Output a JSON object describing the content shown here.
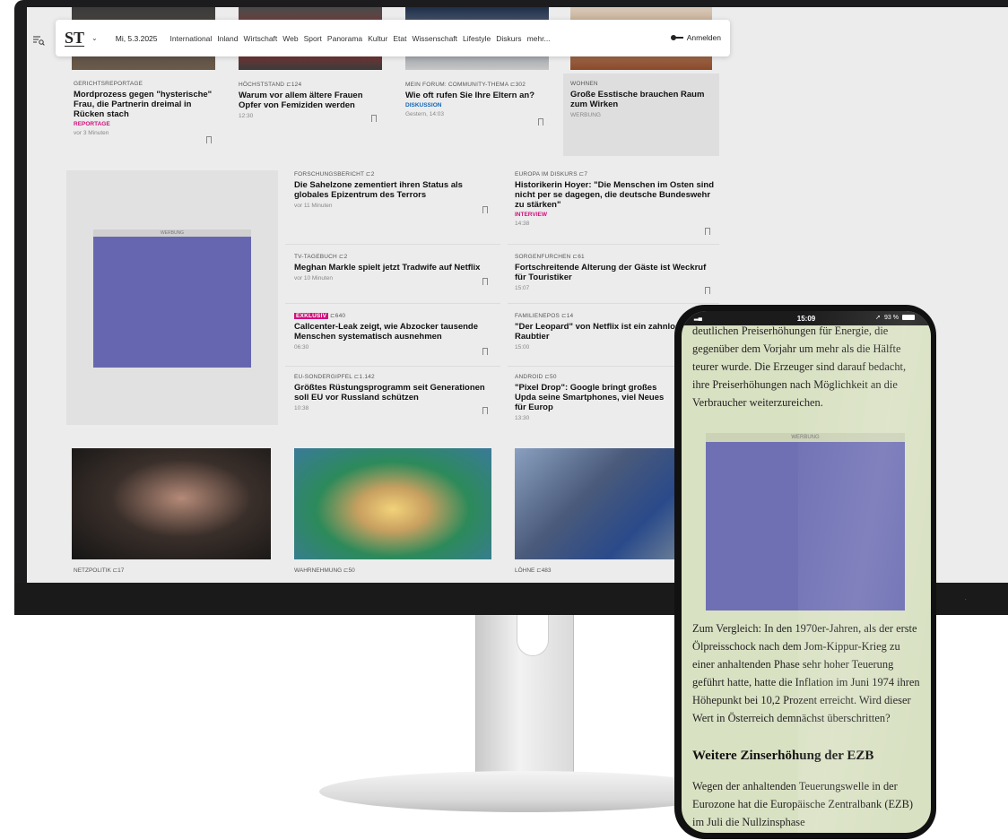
{
  "nav": {
    "logo": "ST",
    "date": "Mi, 5.3.2025",
    "items": [
      "International",
      "Inland",
      "Wirtschaft",
      "Web",
      "Sport",
      "Panorama",
      "Kultur",
      "Etat",
      "Wissenschaft",
      "Lifestyle",
      "Diskurs",
      "mehr..."
    ],
    "login": "Anmelden"
  },
  "top_cards": [
    {
      "kicker": "GERICHTSREPORTAGE",
      "headline": "Mordprozess gegen \"hysterische\" Frau, die Partnerin dreimal in Rücken stach",
      "tag": "REPORTAGE",
      "meta": "vor 3 Minuten"
    },
    {
      "kicker": "HÖCHSTSTAND  ⊏124",
      "headline": "Warum vor allem ältere Frauen Opfer von Femiziden werden",
      "tag": "",
      "meta": "12:30"
    },
    {
      "kicker": "MEIN FORUM: COMMUNITY-THEMA  ⊏302",
      "headline": "Wie oft rufen Sie Ihre Eltern an?",
      "tag": "DISKUSSION",
      "meta": "Gestern, 14:03"
    },
    {
      "kicker": "WOHNEN",
      "headline": "Große Esstische brauchen Raum zum Wirken",
      "tag": "",
      "meta": "WERBUNG"
    }
  ],
  "ad_label": "WERBUNG",
  "mid_left": [
    {
      "kicker": "FORSCHUNGSBERICHT  ⊏2",
      "headline": "Die Sahelzone zementiert ihren Status als globales Epizentrum des Terrors",
      "meta": "vor 11 Minuten"
    },
    {
      "kicker": "TV-TAGEBUCH  ⊏2",
      "headline": "Meghan Markle spielt jetzt Tradwife auf Netflix",
      "meta": "vor 10 Minuten"
    },
    {
      "badge": "EXKLUSIV",
      "kicker": "⊏640",
      "headline": "Callcenter-Leak zeigt, wie Abzocker tausende Menschen systematisch ausnehmen",
      "meta": "06:30"
    },
    {
      "kicker": "EU-SONDERGIPFEL  ⊏1.142",
      "headline": "Größtes Rüstungsprogramm seit Generationen soll EU vor Russland schützen",
      "meta": "10:38"
    }
  ],
  "mid_right": [
    {
      "kicker": "EUROPA IM DISKURS  ⊏7",
      "headline": "Historikerin Hoyer: \"Die Menschen im Osten sind nicht per se dagegen, die deutsche Bundeswehr zu stärken\"",
      "tag": "INTERVIEW",
      "meta": "14:38"
    },
    {
      "kicker": "SORGENFURCHEN  ⊏61",
      "headline": "Fortschreitende Alterung der Gäste ist Weckruf für Touristiker",
      "tag": "",
      "meta": "15:07"
    },
    {
      "kicker": "FAMILIENEPOS  ⊏14",
      "headline": "\"Der Leopard\" von Netflix ist ein zahnlos Raubtier",
      "tag": "",
      "meta": "15:00"
    },
    {
      "kicker": "ANDROID  ⊏50",
      "headline": "\"Pixel Drop\": Google bringt großes Upda seine Smartphones, viel Neues für Europ",
      "tag": "",
      "meta": "13:30"
    }
  ],
  "bottom_cards": [
    {
      "kicker": "NETZPOLITIK  ⊏17"
    },
    {
      "kicker": "WAHRNEHMUNG  ⊏50"
    },
    {
      "kicker": "LÖHNE  ⊏483"
    }
  ],
  "phone": {
    "time": "15:09",
    "battery": "93 %",
    "para1": "deutlichen Preiserhöhungen für Energie, die gegenüber dem Vorjahr um mehr als die Hälfte teurer wurde. Die Erzeuger sind darauf bedacht, ihre Preiserhöhungen nach Möglichkeit an die Verbraucher weiterzureichen.",
    "ad_label": "WERBUNG",
    "para2": "Zum Vergleich: In den 1970er-Jahren, als der erste Ölpreisschock nach dem Jom-Kippur-Krieg zu einer anhaltenden Phase sehr hoher Teuerung geführt hatte, hatte die Inflation im Juni 1974 ihren Höhepunkt bei 10,2 Prozent erreicht. Wird dieser Wert in Österreich demnächst überschritten?",
    "heading": "Weitere Zinserhöhung der EZB",
    "para3": "Wegen der anhaltenden Teuerungswelle in der Eurozone hat die Europäische Zentralbank (EZB) im Juli die Nullzinsphase"
  }
}
